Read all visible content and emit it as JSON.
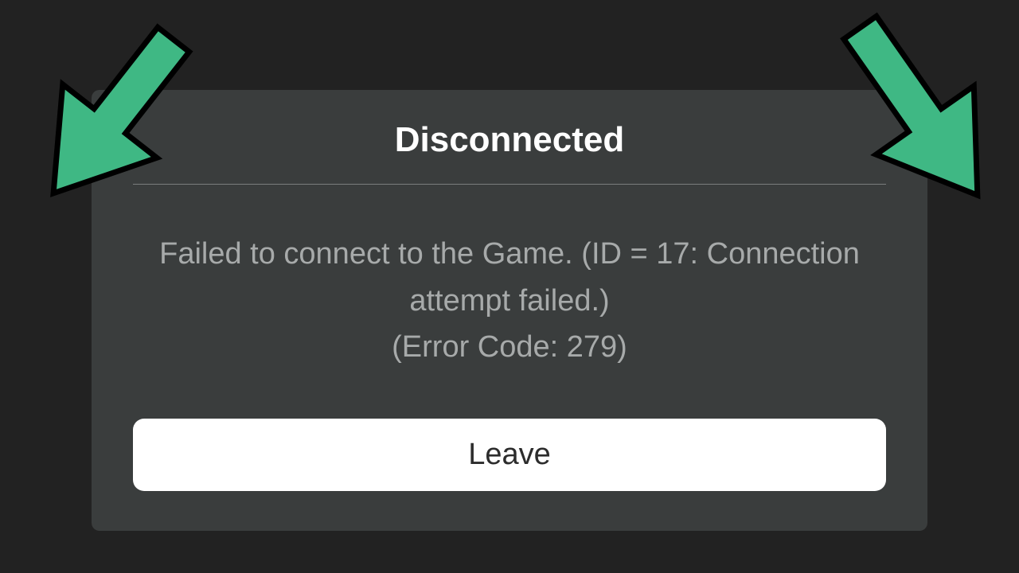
{
  "dialog": {
    "title": "Disconnected",
    "message": "Failed to connect to the Game. (ID = 17: Connection attempt failed.)\n(Error Code: 279)",
    "leave_label": "Leave"
  },
  "colors": {
    "arrow_fill": "#3fb884",
    "arrow_stroke": "#000000"
  }
}
